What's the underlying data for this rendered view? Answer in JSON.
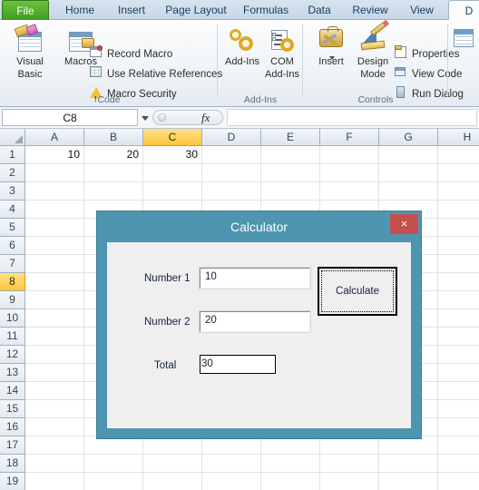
{
  "ribbon": {
    "tabs": [
      {
        "label": "File",
        "kind": "file"
      },
      {
        "label": "Home",
        "kind": "normal"
      },
      {
        "label": "Insert",
        "kind": "normal"
      },
      {
        "label": "Page Layout",
        "kind": "normal"
      },
      {
        "label": "Formulas",
        "kind": "normal"
      },
      {
        "label": "Data",
        "kind": "normal"
      },
      {
        "label": "Review",
        "kind": "normal"
      },
      {
        "label": "View",
        "kind": "normal"
      },
      {
        "label": "D",
        "kind": "selected"
      }
    ],
    "groups": [
      {
        "name": "Code",
        "label": "Code"
      },
      {
        "name": "Add-Ins",
        "label": "Add-Ins"
      },
      {
        "name": "Controls",
        "label": "Controls"
      }
    ],
    "code_group": {
      "visual_basic": "Visual",
      "visual_basic2": "Basic",
      "macros": "Macros",
      "record_macro": "Record Macro",
      "use_relative_references": "Use Relative References",
      "macro_security": "Macro Security"
    },
    "addins_group": {
      "addins": "Add-Ins",
      "com_addins": "COM",
      "com_addins2": "Add-Ins"
    },
    "controls_group": {
      "insert": "Insert",
      "design": "Design",
      "mode": "Mode",
      "properties": "Properties",
      "view_code": "View Code",
      "run_dialog": "Run Dialog"
    }
  },
  "formula_bar": {
    "name_box_value": "C8",
    "fx_label": "fx",
    "formula_value": ""
  },
  "grid": {
    "columns": [
      "A",
      "B",
      "C",
      "D",
      "E",
      "F",
      "G",
      "H"
    ],
    "active_column": "C",
    "rows": [
      "1",
      "2",
      "3",
      "4",
      "5",
      "6",
      "7",
      "8",
      "9",
      "10",
      "11",
      "12",
      "13",
      "14",
      "15",
      "16",
      "17",
      "18",
      "19"
    ],
    "active_row": "8",
    "cells": {
      "A1": "10",
      "B1": "20",
      "C1": "30"
    }
  },
  "dialog": {
    "title": "Calculator",
    "close_label": "×",
    "number1_label": "Number 1",
    "number1_value": "10",
    "number2_label": "Number 2",
    "number2_value": "20",
    "total_label": "Total",
    "total_value": "30",
    "calculate_label": "Calculate"
  },
  "colors": {
    "dialog_frame": "#4d95b0",
    "dialog_body": "#efeff0",
    "close_button": "#c3504f",
    "file_tab_green": "#3f9c1e",
    "active_header": "#ffc63b"
  }
}
